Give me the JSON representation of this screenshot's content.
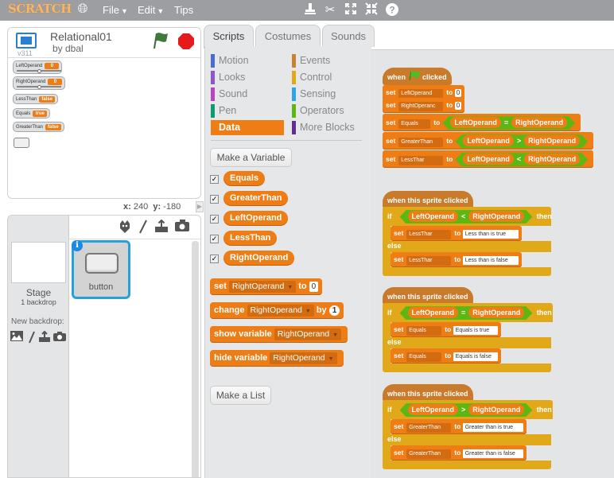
{
  "app": {
    "logo": "SCRATCH"
  },
  "menu": {
    "file": "File",
    "edit": "Edit",
    "tips": "Tips",
    "arrow": "▼"
  },
  "toolbar_icons": [
    "duplicate-stamp-icon",
    "delete-scissors-icon",
    "grow-icon",
    "shrink-icon",
    "help-icon"
  ],
  "project": {
    "title": "Relational01",
    "author": "by dbal",
    "version": "v311"
  },
  "stage": {
    "monitors": [
      {
        "label": "LeftOperand",
        "value": "0",
        "type": "slider"
      },
      {
        "label": "RightOperand",
        "value": "0",
        "type": "slider"
      },
      {
        "label": "LessThan",
        "value": "false",
        "type": "normal"
      },
      {
        "label": "Equals",
        "value": "true",
        "type": "normal"
      },
      {
        "label": "GreaterThan",
        "value": "false",
        "type": "normal"
      }
    ],
    "coords": {
      "x_label": "x:",
      "x": "240",
      "y_label": "y:",
      "y": "-180"
    }
  },
  "sprites_pane": {
    "stage_label": "Stage",
    "backdrop_count": "1 backdrop",
    "new_backdrop": "New backdrop:",
    "sprites": [
      {
        "name": "button",
        "selected": true
      }
    ],
    "info": "i"
  },
  "tabs": [
    "Scripts",
    "Costumes",
    "Sounds"
  ],
  "active_tab": "Scripts",
  "categories": {
    "left": [
      {
        "name": "Motion",
        "color": "#4a6cd4"
      },
      {
        "name": "Looks",
        "color": "#8a55d7"
      },
      {
        "name": "Sound",
        "color": "#bb42c3"
      },
      {
        "name": "Pen",
        "color": "#0e9a6c"
      },
      {
        "name": "Data",
        "color": "#ee7d16"
      }
    ],
    "right": [
      {
        "name": "Events",
        "color": "#c88330"
      },
      {
        "name": "Control",
        "color": "#e1a91a"
      },
      {
        "name": "Sensing",
        "color": "#2ca5e2"
      },
      {
        "name": "Operators",
        "color": "#5cb712"
      },
      {
        "name": "More Blocks",
        "color": "#632d99"
      }
    ],
    "active": "Data"
  },
  "palette": {
    "make_variable": "Make a Variable",
    "make_list": "Make a List",
    "variables": [
      "Equals",
      "GreaterThan",
      "LeftOperand",
      "LessThan",
      "RightOperand"
    ],
    "check": "✓",
    "set": {
      "kw": "set",
      "var": "RightOperand",
      "to": "to",
      "value": "0"
    },
    "change": {
      "kw": "change",
      "var": "RightOperand",
      "by": "by",
      "value": "1"
    },
    "show": {
      "kw": "show variable",
      "var": "RightOperand"
    },
    "hide": {
      "kw": "hide variable",
      "var": "RightOperand"
    },
    "tri": "▼"
  },
  "scripts": {
    "flag_script": {
      "hat_when": "when",
      "hat_clicked": "clicked",
      "set_kw": "set",
      "to_kw": "to",
      "lines": [
        {
          "var": "LeftOperand",
          "value": "0"
        },
        {
          "var": "RightOperanc",
          "value": "0"
        },
        {
          "var": "Equals",
          "left": "LeftOperand",
          "op": "=",
          "right": "RightOperand"
        },
        {
          "var": "GreaterThan",
          "left": "LeftOperand",
          "op": ">",
          "right": "RightOperand"
        },
        {
          "var": "LessThar",
          "left": "LeftOperand",
          "op": "<",
          "right": "RightOperand"
        }
      ]
    },
    "sprite_scripts": [
      {
        "hat": "when this sprite clicked",
        "if": "if",
        "then": "then",
        "else": "else",
        "left": "LeftOperand",
        "op": "<",
        "right": "RightOperand",
        "var": "LessThar",
        "true_text": "Less than is true",
        "false_text": "Less than is false"
      },
      {
        "hat": "when this sprite clicked",
        "if": "if",
        "then": "then",
        "else": "else",
        "left": "LeftOperand",
        "op": "=",
        "right": "RightOperand",
        "var": "Equals",
        "true_text": "Equals is true",
        "false_text": "Equals is false"
      },
      {
        "hat": "when this sprite clicked",
        "if": "if",
        "then": "then",
        "else": "else",
        "left": "LeftOperand",
        "op": ">",
        "right": "RightOperand",
        "var": "GreaterThan",
        "true_text": "Greater than is true",
        "false_text": "Greater than is false"
      }
    ]
  }
}
